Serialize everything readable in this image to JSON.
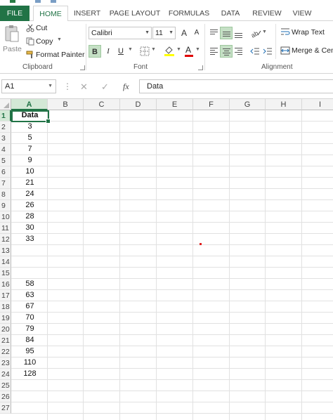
{
  "ribbon_tabs": [
    "FILE",
    "HOME",
    "INSERT",
    "PAGE LAYOUT",
    "FORMULAS",
    "DATA",
    "REVIEW",
    "VIEW"
  ],
  "active_tab": "HOME",
  "clipboard": {
    "paste_label": "Paste",
    "cut_label": "Cut",
    "copy_label": "Copy",
    "format_painter_label": "Format Painter",
    "group_label": "Clipboard"
  },
  "font": {
    "name": "Calibri",
    "size": "11",
    "bold_label": "B",
    "italic_label": "I",
    "underline_label": "U",
    "grow_label": "A",
    "shrink_label": "A",
    "font_color_label": "A",
    "group_label": "Font",
    "font_color": "#e00000",
    "highlight_color": "#ffff00"
  },
  "alignment": {
    "wrap_text_label": "Wrap Text",
    "merge_label": "Merge & Cent",
    "group_label": "Alignment"
  },
  "formula_bar": {
    "name_box": "A1",
    "cancel_symbol": "✕",
    "enter_symbol": "✓",
    "fx_label": "fx",
    "content": "Data"
  },
  "columns": [
    "A",
    "B",
    "C",
    "D",
    "E",
    "F",
    "G",
    "H",
    "I"
  ],
  "selected_column": "A",
  "selected_row": "1",
  "rows": [
    "1",
    "2",
    "3",
    "4",
    "5",
    "6",
    "7",
    "8",
    "9",
    "10",
    "11",
    "12",
    "13",
    "14",
    "15",
    "16",
    "17",
    "18",
    "19",
    "20",
    "21",
    "22",
    "23",
    "24",
    "25",
    "26",
    "27"
  ],
  "column_a": [
    "Data",
    "3",
    "5",
    "7",
    "9",
    "10",
    "21",
    "24",
    "26",
    "28",
    "30",
    "33",
    "",
    "",
    "",
    "58",
    "63",
    "67",
    "70",
    "79",
    "84",
    "95",
    "110",
    "128",
    "",
    "",
    ""
  ],
  "accent_color": "#217346"
}
